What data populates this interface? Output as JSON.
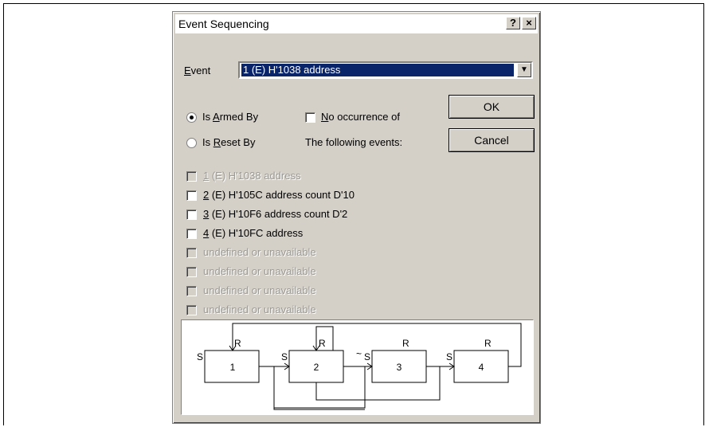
{
  "dialog": {
    "title": "Event Sequencing",
    "help_button": "?",
    "close_button": "×"
  },
  "event_field": {
    "label_prefix": "",
    "label_ul": "E",
    "label_rest": "vent",
    "selected_value": "1 (E) H'1038 address"
  },
  "buttons": {
    "ok": "OK",
    "cancel": "Cancel"
  },
  "options": {
    "armed_ul": "A",
    "armed_pre": "Is ",
    "armed_post": "rmed By",
    "reset_pre": "Is ",
    "reset_ul": "R",
    "reset_post": "eset By",
    "no_occ_ul": "N",
    "no_occ_post": "o occurrence of",
    "following": "The following events:"
  },
  "events": [
    {
      "num": "1",
      "text": " (E) H'1038 address",
      "disabled": true
    },
    {
      "num": "2",
      "text": " (E) H'105C address count D'10",
      "disabled": false
    },
    {
      "num": "3",
      "text": " (E) H'10F6 address count D'2",
      "disabled": false
    },
    {
      "num": "4",
      "text": " (E) H'10FC address",
      "disabled": false
    },
    {
      "num": "",
      "text": "undefined or unavailable",
      "disabled": true
    },
    {
      "num": "",
      "text": "undefined or unavailable",
      "disabled": true
    },
    {
      "num": "",
      "text": "undefined or unavailable",
      "disabled": true
    },
    {
      "num": "",
      "text": "undefined or unavailable",
      "disabled": true
    }
  ],
  "diagram": {
    "boxes": [
      "1",
      "2",
      "3",
      "4"
    ],
    "set_label": "S",
    "reset_label": "R",
    "not_label": "~"
  }
}
